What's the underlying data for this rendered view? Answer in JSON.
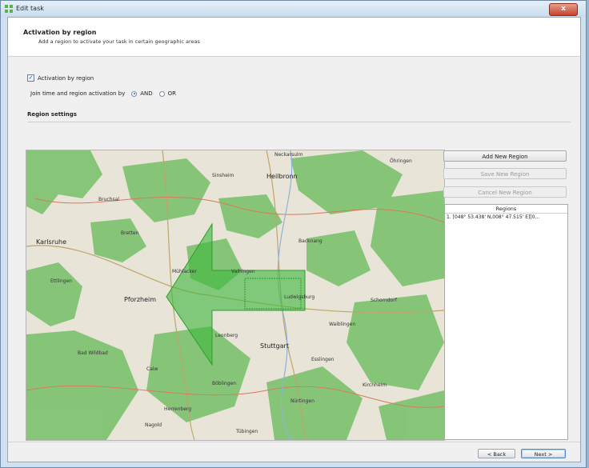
{
  "window": {
    "title": "Edit task",
    "close_label": "x"
  },
  "header": {
    "title": "Activation by region",
    "subtitle": "Add a region to activate your task in certain geographic areas"
  },
  "activation": {
    "checkbox_label": "Activation by region",
    "checked": true,
    "join_label": "Join time and region activation by",
    "options": [
      {
        "label": "AND",
        "selected": true
      },
      {
        "label": "OR",
        "selected": false
      }
    ]
  },
  "region_settings": {
    "title": "Region settings"
  },
  "map": {
    "labels": [
      "Karlsruhe",
      "Pforzheim",
      "Heilbronn",
      "Stuttgart",
      "Bruchsal",
      "Sinsheim",
      "Bretten",
      "Mühlacker",
      "Vaihingen",
      "Ludwigsburg",
      "Esslingen",
      "Calw",
      "Nagold",
      "Herrenberg",
      "Böblingen",
      "Tübingen",
      "Backnang",
      "Schorndorf",
      "Waiblingen",
      "Kirchheim",
      "Nürtingen",
      "Leonberg",
      "Bad Wildbad",
      "Ettlingen",
      "Neckarsulm",
      "Öhringen"
    ]
  },
  "actions": {
    "add": "Add New Region",
    "save": "Save New Region",
    "cancel": "Cancel New Region"
  },
  "regions": {
    "header": "Regions",
    "items": [
      "1. [048° 53.438' N,008° 47.515' E][0..."
    ]
  },
  "nav": {
    "back": "< Back",
    "next": "Next >"
  },
  "colors": {
    "accent": "#3a6fb0",
    "arrow_fill": "#3cb83c",
    "forest": "#7cc26e",
    "land": "#e8e4d8"
  }
}
